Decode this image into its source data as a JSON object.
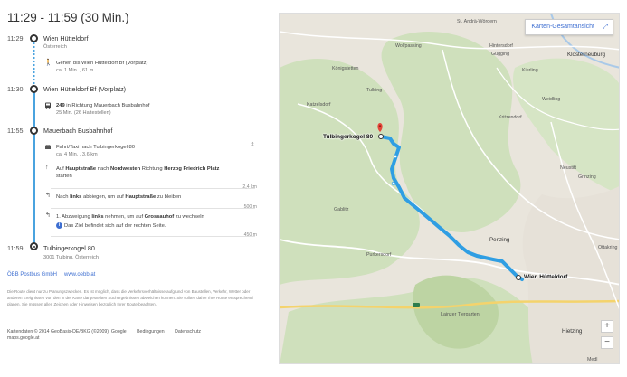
{
  "title": "11:29 - 11:59 (30 Min.)",
  "itinerary": {
    "t1": "11:29",
    "stop1": "Wien Hütteldorf",
    "stop1_sub": "Österreich",
    "walk_text": "Gehen bis Wien Hütteldorf Bf (Vorplatz)",
    "walk_sub": "ca. 1 Min. , 61 m",
    "t2": "11:30",
    "stop2": "Wien Hütteldorf Bf (Vorplatz)",
    "bus_line": "249",
    "bus_text": " in Richtung Mauerbach Busbahnhof",
    "bus_sub": "25 Min. (26 Haltestellen)",
    "t3": "11:55",
    "stop3": "Mauerbach Busbahnhof",
    "taxi_text": "Fahrt/Taxi nach Tulbingerkogel 80",
    "taxi_sub": "ca. 4 Min. , 3,6 km",
    "step1_a": "Auf ",
    "step1_b": "Hauptstraße",
    "step1_c": " nach ",
    "step1_d": "Nordwesten",
    "step1_e": " Richtung ",
    "step1_f": "Herzog Friedrich Platz",
    "step1_g": "starten",
    "dist1": "2,4 km",
    "step2_a": "Nach ",
    "step2_b": "links",
    "step2_c": " abbiegen, um auf ",
    "step2_d": "Hauptstraße",
    "step2_e": " zu bleiben",
    "dist2": "500 m",
    "step3_a": "1. Abzweigung ",
    "step3_b": "links",
    "step3_c": " nehmen, um auf ",
    "step3_d": "Grossauhof",
    "step3_e": " zu wechseln",
    "step3_note": "Das Ziel befindet sich auf der rechten Seite.",
    "dist3": "450 m",
    "t4": "11:59",
    "stop4": "Tulbingerkogel 80",
    "stop4_sub": "3001 Tulbing, Österreich"
  },
  "agency": "ÖBB Postbus GmbH",
  "agency_url": "www.oebb.at",
  "disclaimer": "Die Route dient nur zu Planungszwecken. Es ist möglich, dass die Verkehrsverhältnisse aufgrund von Baustellen, Verkehr, Wetter oder anderen Ereignissen von den in der Karte dargestellten Suchergebnissen abweichen können. Sie sollten daher Ihre Route entsprechend planen. Sie müssen allen Zeichen oder Hinweisen bezüglich Ihrer Route beachten.",
  "footer": {
    "mapdata": "Kartendaten © 2014 GeoBasis-DE/BKG (©2009), Google",
    "terms": "Bedingungen",
    "privacy": "Datenschutz",
    "domain": "maps.google.at"
  },
  "map": {
    "overview_button": "Karten-Gesamtansicht",
    "zoom_in": "+",
    "zoom_out": "−",
    "origin_label": "Wien Hütteldorf",
    "dest_label": "Tulbingerkogel 80",
    "places": {
      "p_standre": "St. Andrä-Wördern",
      "p_wolfpassing": "Wolfpassing",
      "p_hintersdorf": "Hintersdorf",
      "p_klosterneuburg": "Klosterneuburg",
      "p_gugging": "Gugging",
      "p_konigstetten": "Königstetten",
      "p_kierling": "Kierling",
      "p_tulbing": "Tulbing",
      "p_katzelsdorf": "Katzelsdorf",
      "p_weidling": "Weidling",
      "p_kritzendorf": "Kritzendorf",
      "p_neustift": "Neustift",
      "p_grinzing": "Grinzing",
      "p_gablitz": "Gablitz",
      "p_penzing": "Penzing",
      "p_purkersdorf": "Purkersdorf",
      "p_ottakring": "Ottakring",
      "p_lainz": "Lainzer Tiergarten",
      "p_hietzing": "Hietzing",
      "p_medling": "Medl"
    },
    "colors": {
      "route": "#2f9ee3",
      "forest": "#cfe0bc",
      "forest_light": "#dbe8c9",
      "urban": "#e8e4dc",
      "road": "#ffffff",
      "highway": "#f4d36c",
      "pin": "#e4473a"
    }
  }
}
